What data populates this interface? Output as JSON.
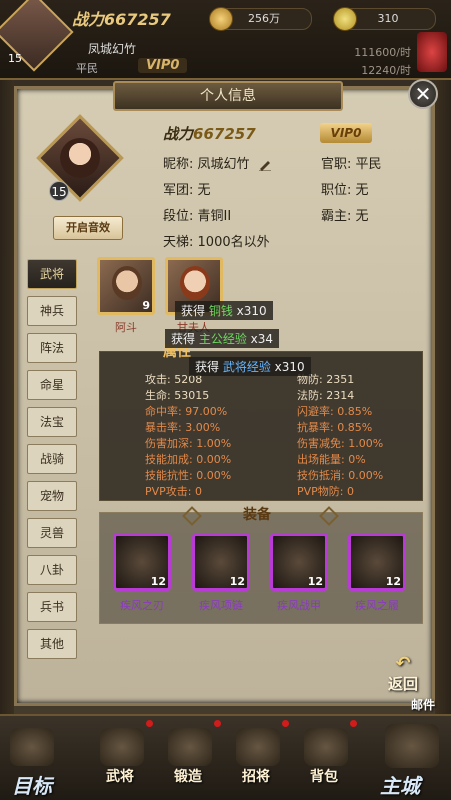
{
  "hud": {
    "level": "15",
    "power_label": "战力",
    "power_value": "667257",
    "name": "凤城幻竹",
    "rank": "平民",
    "vip": "VIP0",
    "copper": "256万",
    "gold": "310",
    "copper_rate": "111600/时",
    "other_rate": "12240/时"
  },
  "panel": {
    "title": "个人信息",
    "close": "✕",
    "portrait_level": "15",
    "sound_button": "开启音效",
    "power_label": "战力",
    "power_value": "667257",
    "vip": "VIP0",
    "nickname_label": "昵称:",
    "nickname": "凤城幻竹",
    "legion_label": "军团:",
    "legion": "无",
    "tier_label": "段位:",
    "tier": "青铜II",
    "ladder_label": "天梯:",
    "ladder": "1000名以外",
    "office_label": "官职:",
    "office": "平民",
    "position_label": "职位:",
    "position": "无",
    "overlord_label": "霸主:",
    "overlord": "无"
  },
  "tabs": [
    "武将",
    "神兵",
    "阵法",
    "命星",
    "法宝",
    "战骑",
    "宠物",
    "灵兽",
    "八卦",
    "兵书",
    "其他"
  ],
  "heroes": [
    {
      "name": "阿斗",
      "count": "9"
    },
    {
      "name": "甘夫人",
      "count": ""
    }
  ],
  "toasts": [
    {
      "prefix": "获得 ",
      "item": "铜钱",
      "suffix": " x310"
    },
    {
      "prefix": "获得 ",
      "item": "主公经验",
      "suffix": " x34"
    },
    {
      "prefix": "获得 ",
      "item": "武将经验",
      "suffix": " x310"
    }
  ],
  "attributes": {
    "title": "属性",
    "attack": "攻击: 5208",
    "life": "生命: 53015",
    "phys_def": "物防: 2351",
    "mag_def": "法防: 2314",
    "hit": "命中率: 97.00%",
    "crit": "暴击率: 3.00%",
    "dmg_boost": "伤害加深: 1.00%",
    "skill_boost": "技能加成: 0.00%",
    "skill_resist": "技能抗性: 0.00%",
    "pvp_attack": "PVP攻击: 0",
    "dodge": "闪避率: 0.85%",
    "anti_crit": "抗暴率: 0.85%",
    "dmg_reduce": "伤害减免: 1.00%",
    "entry_energy": "出场能量: 0%",
    "skill_negate": "技伤抵消: 0.00%",
    "pvp_mdef": "PVP物防: 0"
  },
  "equipment": {
    "title": "装备",
    "items": [
      {
        "name": "疾风之刃",
        "level": "12"
      },
      {
        "name": "疾风项链",
        "level": "12"
      },
      {
        "name": "疾风战甲",
        "level": "12"
      },
      {
        "name": "疾风之履",
        "level": "12"
      }
    ]
  },
  "return_label": "返回",
  "mail_label": "邮件",
  "bottom_nav": [
    "目标",
    "武将",
    "锻造",
    "招将",
    "背包",
    "主城"
  ]
}
